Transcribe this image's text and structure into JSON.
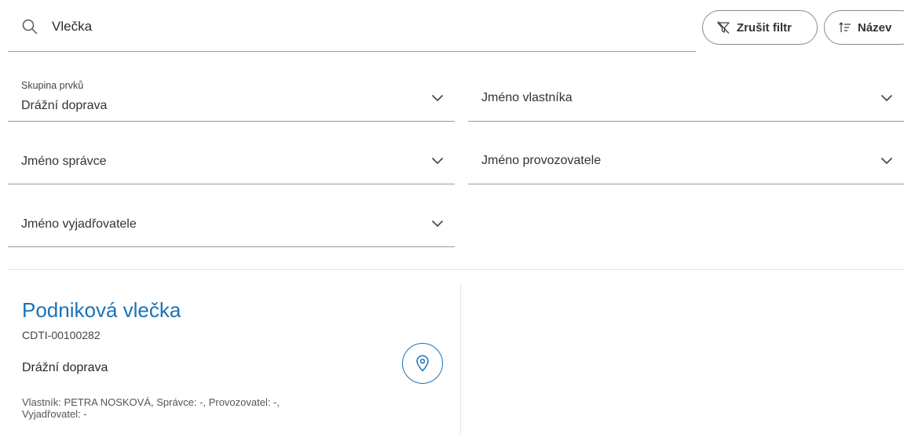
{
  "search": {
    "value": "Vlečka"
  },
  "toolbar": {
    "clear_filter_label": "Zrušit filtr",
    "sort_label": "Název"
  },
  "filters": {
    "group": {
      "label": "Skupina prvků",
      "value": "Drážní doprava"
    },
    "owner": {
      "label": "Jméno vlastníka"
    },
    "administrator": {
      "label": "Jméno správce"
    },
    "operator": {
      "label": "Jméno provozovatele"
    },
    "commenter": {
      "label": "Jméno vyjadřovatele"
    }
  },
  "result": {
    "title": "Podniková vlečka",
    "id": "CDTI-00100282",
    "group": "Drážní doprava",
    "meta_line1": "Vlastník: PETRA NOSKOVÁ, Správce: -, Provozovatel: -,",
    "meta_line2": "Vyjadřovatel: -"
  },
  "colors": {
    "accent": "#1a73b8",
    "border": "#9a9a9a",
    "divider": "#e3e3e3"
  },
  "icons": [
    "search-icon",
    "filter-off-icon",
    "sort-icon",
    "chevron-down-icon",
    "map-pin-icon"
  ]
}
